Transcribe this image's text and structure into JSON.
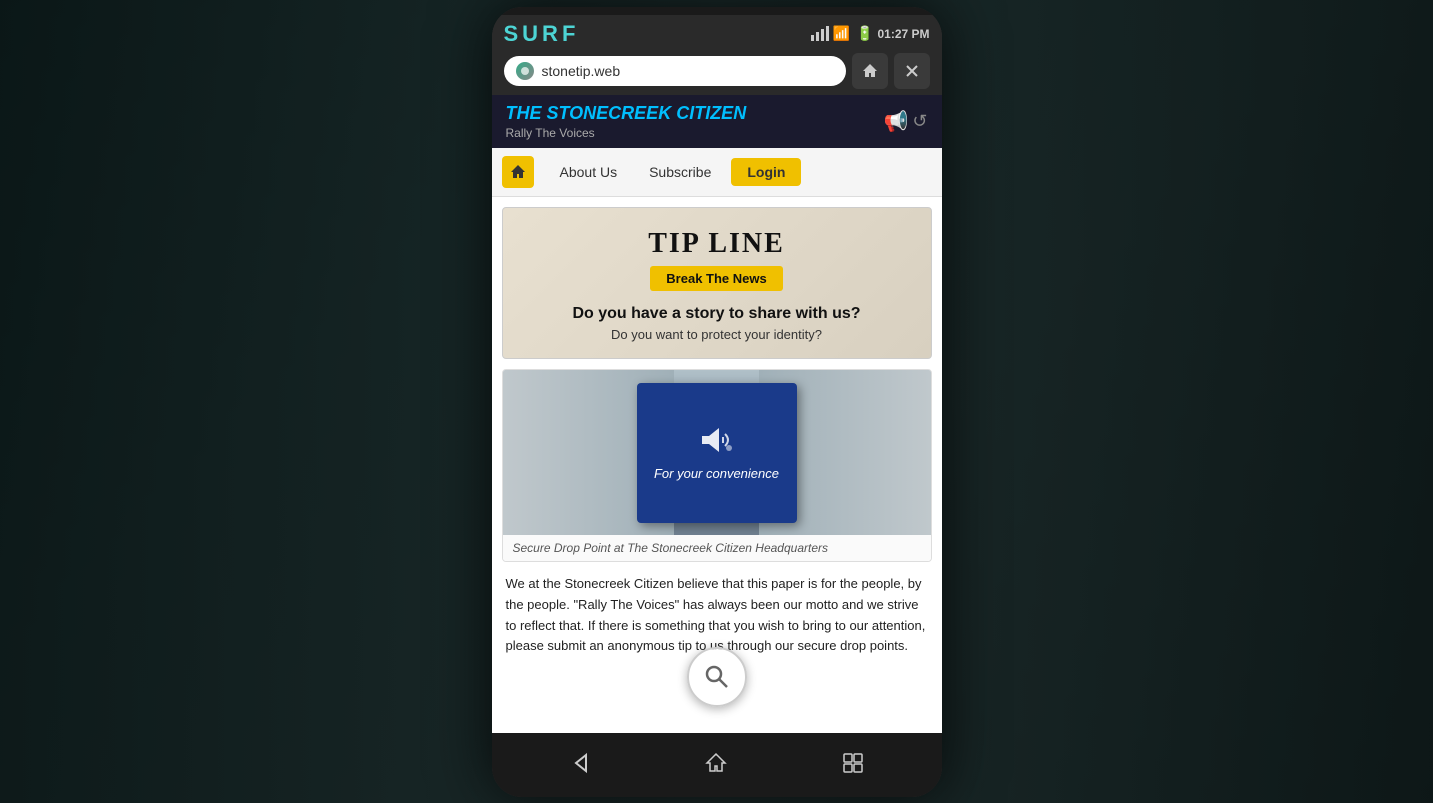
{
  "background": {
    "color": "#1a2a2a"
  },
  "browser": {
    "app_name": "SURF",
    "url": "stonetip.web",
    "time": "01:27 PM",
    "home_tooltip": "Home",
    "close_tooltip": "Close"
  },
  "site": {
    "name": "The Stonecreek Citizen",
    "tagline": "Rally The Voices",
    "nav": {
      "about": "About Us",
      "subscribe": "Subscribe",
      "login": "Login"
    }
  },
  "tip_line": {
    "title": "TIP LINE",
    "cta_button": "Break The News",
    "question1": "Do you have a story to share with us?",
    "question2": "Do you want to protect your identity?",
    "image_caption": "Secure Drop Point at The Stonecreek Citizen Headquarters",
    "dropbox_label": "For your convenience"
  },
  "article": {
    "body": "We at the Stonecreek Citizen believe that this paper is for the people, by the people. \"Rally The Voices\" has always been our motto and we strive to reflect that. If there is something that you wish to bring to our attention, please submit an anonymous tip to us through our secure drop points."
  },
  "bottom_nav": {
    "back": "back",
    "home": "home",
    "apps": "apps"
  }
}
